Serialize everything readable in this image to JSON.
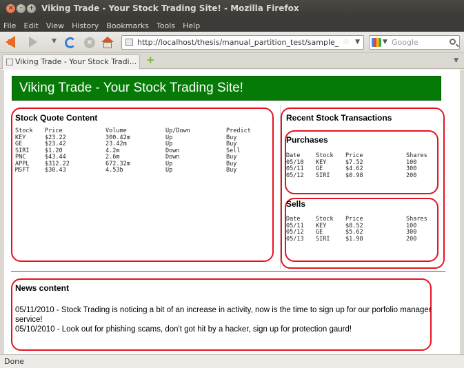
{
  "window": {
    "title": "Viking Trade - Your Stock Trading Site! - Mozilla Firefox"
  },
  "menu": [
    "File",
    "Edit",
    "View",
    "History",
    "Bookmarks",
    "Tools",
    "Help"
  ],
  "nav": {
    "url": "http://localhost/thesis/manual_partition_test/sample_page.",
    "search_placeholder": "Google"
  },
  "tab": {
    "label": "Viking Trade - Your Stock Tradi..."
  },
  "page": {
    "banner_title": "Viking Trade - Your Stock Trading Site!",
    "quotes": {
      "heading": "Stock Quote Content",
      "columns": [
        "Stock",
        "Price",
        "Volume",
        "Up/Down",
        "Predict"
      ],
      "rows": [
        [
          "KEY",
          "$23.22",
          "300.42m",
          "Up",
          "Buy"
        ],
        [
          "GE",
          "$23.42",
          "23.42m",
          "Up",
          "Buy"
        ],
        [
          "SIRI",
          "$1.20",
          "4.2m",
          "Down",
          "Sell"
        ],
        [
          "PNC",
          "$43.44",
          "2.6m",
          "Down",
          "Buy"
        ],
        [
          "APPL",
          "$312.22",
          "672.32m",
          "Up",
          "Buy"
        ],
        [
          "MSFT",
          "$30.43",
          "4.53b",
          "Up",
          "Buy"
        ]
      ]
    },
    "transactions": {
      "heading": "Recent Stock Transactions",
      "purchases": {
        "heading": "Purchases",
        "columns": [
          "Date",
          "Stock",
          "Price",
          "Shares"
        ],
        "rows": [
          [
            "05/10",
            "KEY",
            "$7.52",
            "100"
          ],
          [
            "05/11",
            "GE",
            "$4.62",
            "300"
          ],
          [
            "05/12",
            "SIRI",
            "$0.98",
            "200"
          ]
        ]
      },
      "sells": {
        "heading": "Sells",
        "columns": [
          "Date",
          "Stock",
          "Price",
          "Shares"
        ],
        "rows": [
          [
            "05/11",
            "KEY",
            "$8.52",
            "100"
          ],
          [
            "05/12",
            "GE",
            "$5.62",
            "300"
          ],
          [
            "05/13",
            "SIRI",
            "$1.98",
            "200"
          ]
        ]
      }
    },
    "news": {
      "heading": "News content",
      "items": [
        "05/11/2010 - Stock Trading is noticing a bit of an increase in activity, now is the time to sign up for our porfolio manager service!",
        "05/10/2010 - Look out for phishing scams, don't got hit by a hacker, sign up for protection gaurd!"
      ]
    }
  },
  "status": {
    "text": "Done"
  },
  "colors": {
    "banner": "#067a06",
    "panel_border": "#e8121e"
  }
}
